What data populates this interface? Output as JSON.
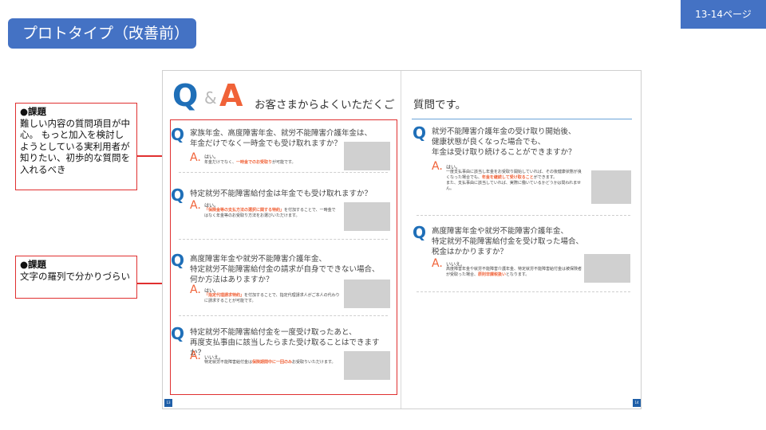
{
  "slide": {
    "title": "プロトタイプ（改善前）",
    "page_tag": "13-14ページ",
    "accent_color": "#4472c4",
    "highlight_color": "#e03030"
  },
  "notes": [
    {
      "head": "●課題",
      "body": "難しい内容の質問項目が中心。\nもっと加入を検討しようとしている実利用者が知りたい、初歩的な質問を入れるべき"
    },
    {
      "head": "●課題",
      "body": "文字の羅列で分かりづらい"
    }
  ],
  "book": {
    "logo": {
      "q": "Q",
      "amp": "&",
      "a": "A"
    },
    "header_left": "お客さまからよくいただくご",
    "header_right": "質問です。",
    "page_left": "13",
    "page_right": "14",
    "left_items": [
      {
        "q": "家族年金、高度障害年金、就労不能障害介護年金は、\n年金だけでなく一時金でも受け取れますか？",
        "a_head": "はい。",
        "a_pre": "年金だけでなく、",
        "a_hl": "一時金でのお受取り",
        "a_post": "が可能です。"
      },
      {
        "q": "特定就労不能障害給付金は年金でも受け取れますか？",
        "a_head": "はい。",
        "a_pre": "",
        "a_hl": "「保険金等の支払方法の選択に関する特約」",
        "a_post": "を付加することで、一時金ではなく年金等のお受取り方法をお選びいただけます。"
      },
      {
        "q": "高度障害年金や就労不能障害介護年金、\n特定就労不能障害給付金の請求が自身でできない場合、\n何か方法はありますか？",
        "a_head": "はい。",
        "a_pre": "",
        "a_hl": "「指定代理請求特約」",
        "a_post": "を付加することで、指定代理請求人がご本人の代わりに請求することが可能です。"
      },
      {
        "q": "特定就労不能障害給付金を一度受け取ったあと、\n再度支払事由に該当したらまた受け取ることはできますか？",
        "a_head": "いいえ。",
        "a_pre": "特定就労不能障害給付金は",
        "a_hl": "保険期間中に一回のみ",
        "a_post": "お受取りいただけます。"
      }
    ],
    "right_items": [
      {
        "q": "就労不能障害介護年金の受け取り開始後、\n健康状態が良くなった場合でも、\n年金は受け取り続けることができますか？",
        "a_head": "はい。",
        "a_pre": "一度支払事由に該当し年金をお受取り開始していれば、その後健康状態が良くなった場合でも、",
        "a_hl": "年金を継続して受け取ること",
        "a_post": "ができます。\nまた、支払事由に該当していれば、実際に働いているかどうかは問われません。"
      },
      {
        "q": "高度障害年金や就労不能障害介護年金、\n特定就労不能障害給付金を受け取った場合、\n税金はかかりますか？",
        "a_head": "いいえ。",
        "a_pre": "高度障害年金や就労不能障害介護年金、特定就労不能障害給付金は被保険者が受取った場合、",
        "a_hl": "原則非課税扱い",
        "a_post": "となります。"
      }
    ]
  }
}
